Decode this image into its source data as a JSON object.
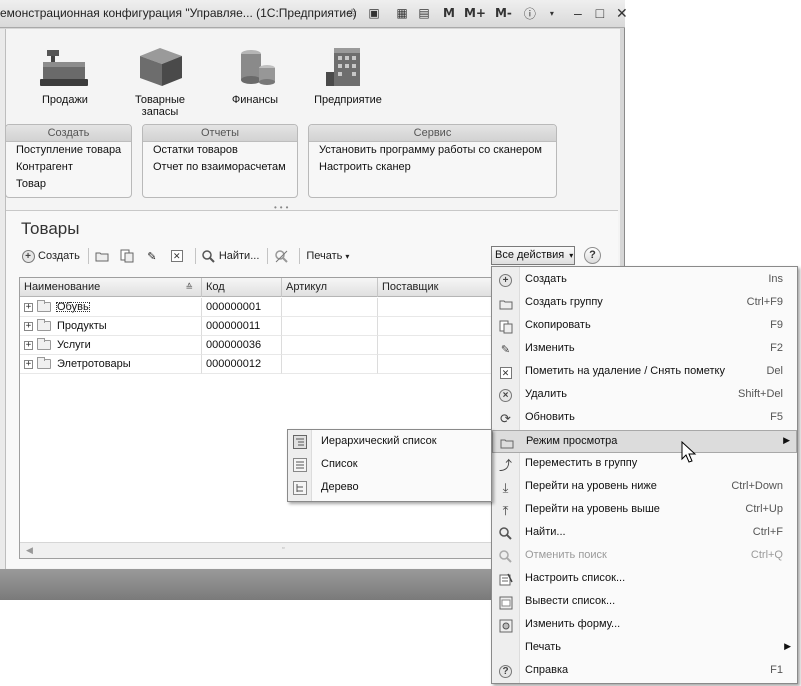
{
  "window": {
    "title": "емонстрационная конфигурация \"Управляе... (1С:Предприятие)",
    "toolbar_text": [
      "M",
      "M+",
      "M-"
    ]
  },
  "sections": [
    {
      "label": "Продажи",
      "icon": "cash-register-icon"
    },
    {
      "label": "Товарные запасы",
      "icon": "box-icon"
    },
    {
      "label": "Финансы",
      "icon": "coins-icon"
    },
    {
      "label": "Предприятие",
      "icon": "building-icon"
    }
  ],
  "groups": {
    "create": {
      "title": "Создать",
      "items": [
        "Поступление товара",
        "Контрагент",
        "Товар"
      ]
    },
    "reports": {
      "title": "Отчеты",
      "items": [
        "Остатки товаров",
        "Отчет по взаиморасчетам"
      ]
    },
    "service": {
      "title": "Сервис",
      "items": [
        "Установить программу работы со сканером",
        "Настроить сканер"
      ]
    }
  },
  "form": {
    "title": "Товары",
    "commands": {
      "create": "Создать",
      "find": "Найти...",
      "print": "Печать",
      "all_actions": "Все действия",
      "help": "?"
    }
  },
  "grid": {
    "columns": [
      "Наименование",
      "Код",
      "Артикул",
      "Поставщик"
    ],
    "rows": [
      {
        "name": "Обувь",
        "code": "000000001",
        "article": "",
        "supplier": ""
      },
      {
        "name": "Продукты",
        "code": "000000011",
        "article": "",
        "supplier": ""
      },
      {
        "name": "Услуги",
        "code": "000000036",
        "article": "",
        "supplier": ""
      },
      {
        "name": "Элетротовары",
        "code": "000000012",
        "article": "",
        "supplier": ""
      }
    ]
  },
  "menu": {
    "items": [
      {
        "label": "Создать",
        "shortcut": "Ins",
        "icon": "plus-circle-icon"
      },
      {
        "label": "Создать группу",
        "shortcut": "Ctrl+F9",
        "icon": "new-folder-icon"
      },
      {
        "label": "Скопировать",
        "shortcut": "F9",
        "icon": "copy-icon"
      },
      {
        "label": "Изменить",
        "shortcut": "F2",
        "icon": "pencil-icon"
      },
      {
        "label": "Пометить на удаление / Снять пометку",
        "shortcut": "Del",
        "icon": "delete-mark-icon"
      },
      {
        "label": "Удалить",
        "shortcut": "Shift+Del",
        "icon": "delete-circle-icon"
      },
      {
        "label": "Обновить",
        "shortcut": "F5",
        "icon": "refresh-icon"
      },
      {
        "label": "Режим просмотра",
        "shortcut": "",
        "icon": "view-mode-icon",
        "submenu": true
      },
      {
        "label": "Переместить в группу",
        "shortcut": "",
        "icon": "move-to-group-icon"
      },
      {
        "label": "Перейти на уровень ниже",
        "shortcut": "Ctrl+Down",
        "icon": "level-down-icon"
      },
      {
        "label": "Перейти на уровень выше",
        "shortcut": "Ctrl+Up",
        "icon": "level-up-icon"
      },
      {
        "label": "Найти...",
        "shortcut": "Ctrl+F",
        "icon": "search-icon"
      },
      {
        "label": "Отменить поиск",
        "shortcut": "Ctrl+Q",
        "icon": "cancel-search-icon",
        "disabled": true
      },
      {
        "label": "Настроить список...",
        "shortcut": "",
        "icon": "list-settings-icon"
      },
      {
        "label": "Вывести список...",
        "shortcut": "",
        "icon": "output-list-icon"
      },
      {
        "label": "Изменить форму...",
        "shortcut": "",
        "icon": "form-settings-icon"
      },
      {
        "label": "Печать",
        "shortcut": "",
        "icon": "",
        "submenu": true
      },
      {
        "label": "Справка",
        "shortcut": "F1",
        "icon": "help-icon"
      }
    ]
  },
  "submenu": {
    "items": [
      {
        "label": "Иерархический список",
        "icon": "hierarchical-list-icon",
        "selected": true
      },
      {
        "label": "Список",
        "icon": "list-icon",
        "selected": false
      },
      {
        "label": "Дерево",
        "icon": "tree-icon",
        "selected": false
      }
    ]
  }
}
